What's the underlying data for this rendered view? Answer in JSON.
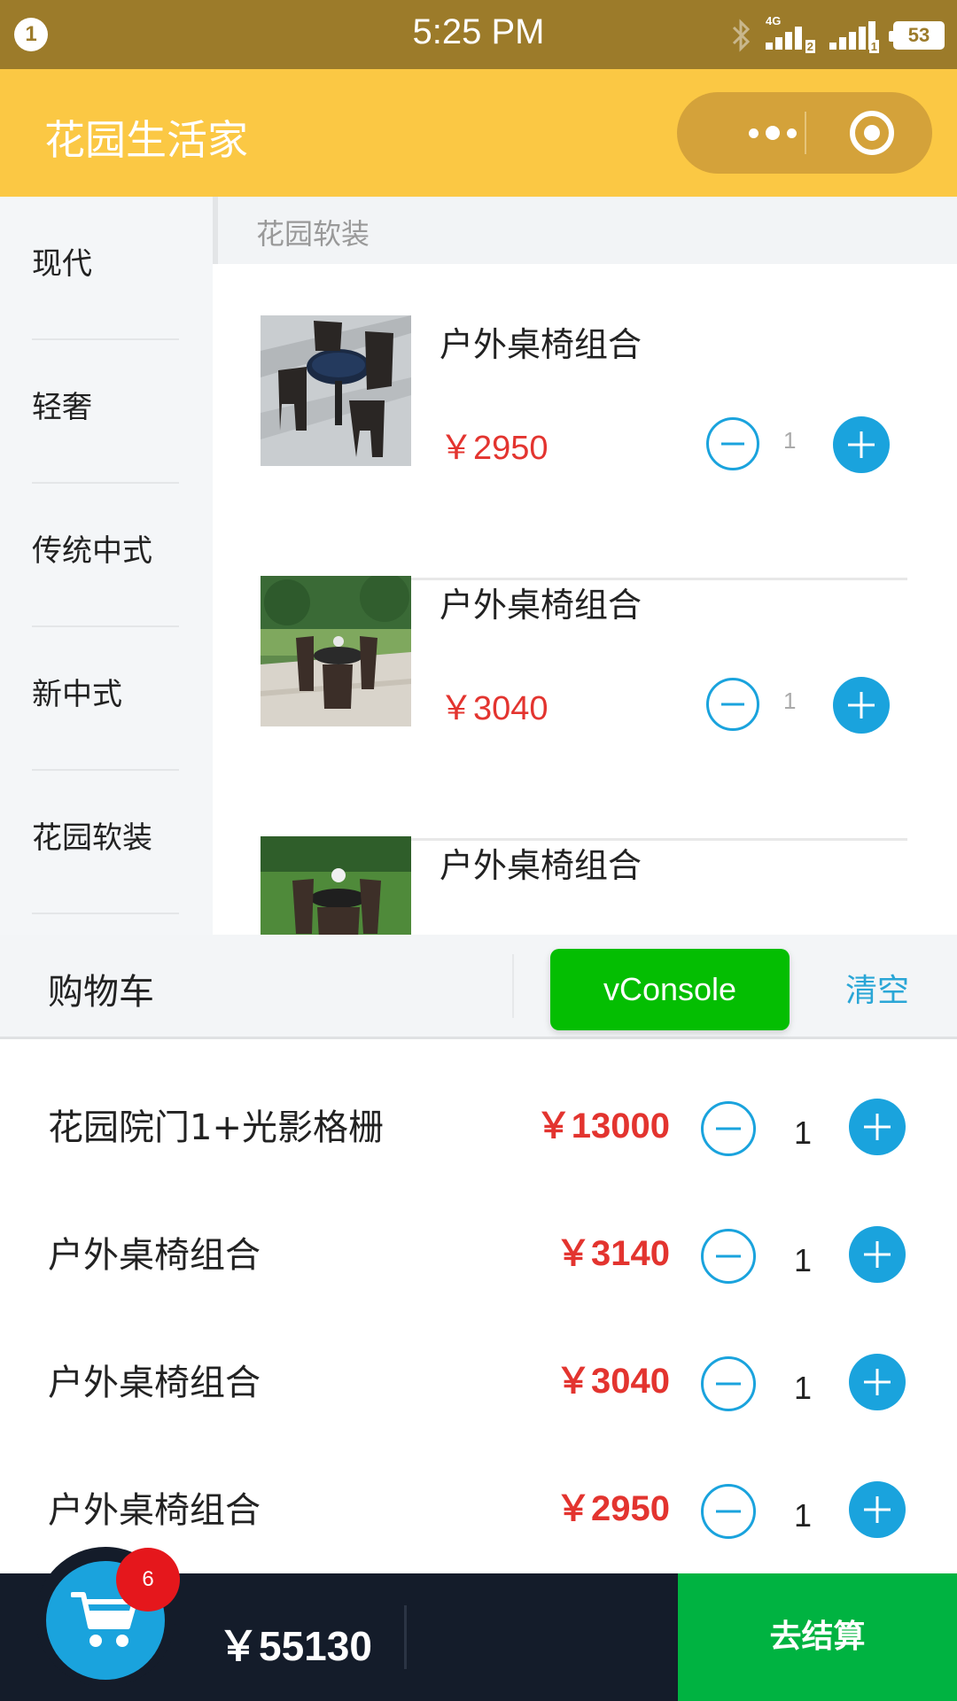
{
  "status_bar": {
    "notification_count": "1",
    "time": "5:25 PM",
    "network_type": "4G",
    "sim1": "2",
    "sim2": "1",
    "battery": "53"
  },
  "title_bar": {
    "title": "花园生活家"
  },
  "sidebar": {
    "items": [
      {
        "label": "现代"
      },
      {
        "label": "轻奢"
      },
      {
        "label": "传统中式"
      },
      {
        "label": "新中式"
      },
      {
        "label": "花园软装"
      }
    ]
  },
  "section": {
    "title": "花园软装"
  },
  "products": [
    {
      "name": "户外桌椅组合",
      "price": "￥2950",
      "qty": "1"
    },
    {
      "name": "户外桌椅组合",
      "price": "￥3040",
      "qty": "1"
    },
    {
      "name": "户外桌椅组合",
      "price": "",
      "qty": ""
    }
  ],
  "cart": {
    "title": "购物车",
    "clear_label": "清空",
    "vconsole_label": "vConsole",
    "items": [
      {
        "name": "花园院门1+光影格栅",
        "price": "￥13000",
        "qty": "1"
      },
      {
        "name": "户外桌椅组合",
        "price": "￥3140",
        "qty": "1"
      },
      {
        "name": "户外桌椅组合",
        "price": "￥3040",
        "qty": "1"
      },
      {
        "name": "户外桌椅组合",
        "price": "￥2950",
        "qty": "1"
      }
    ]
  },
  "bottom_bar": {
    "badge_count": "6",
    "total": "￥55130",
    "checkout_label": "去结算"
  },
  "colors": {
    "title_bar": "#fbc844",
    "status_bar": "#9c7b2a",
    "accent_blue": "#1aa3dd",
    "price_red": "#e3342f",
    "checkout_green": "#00b341",
    "vconsole_green": "#04be02",
    "bottom_bar": "#141c2a"
  }
}
